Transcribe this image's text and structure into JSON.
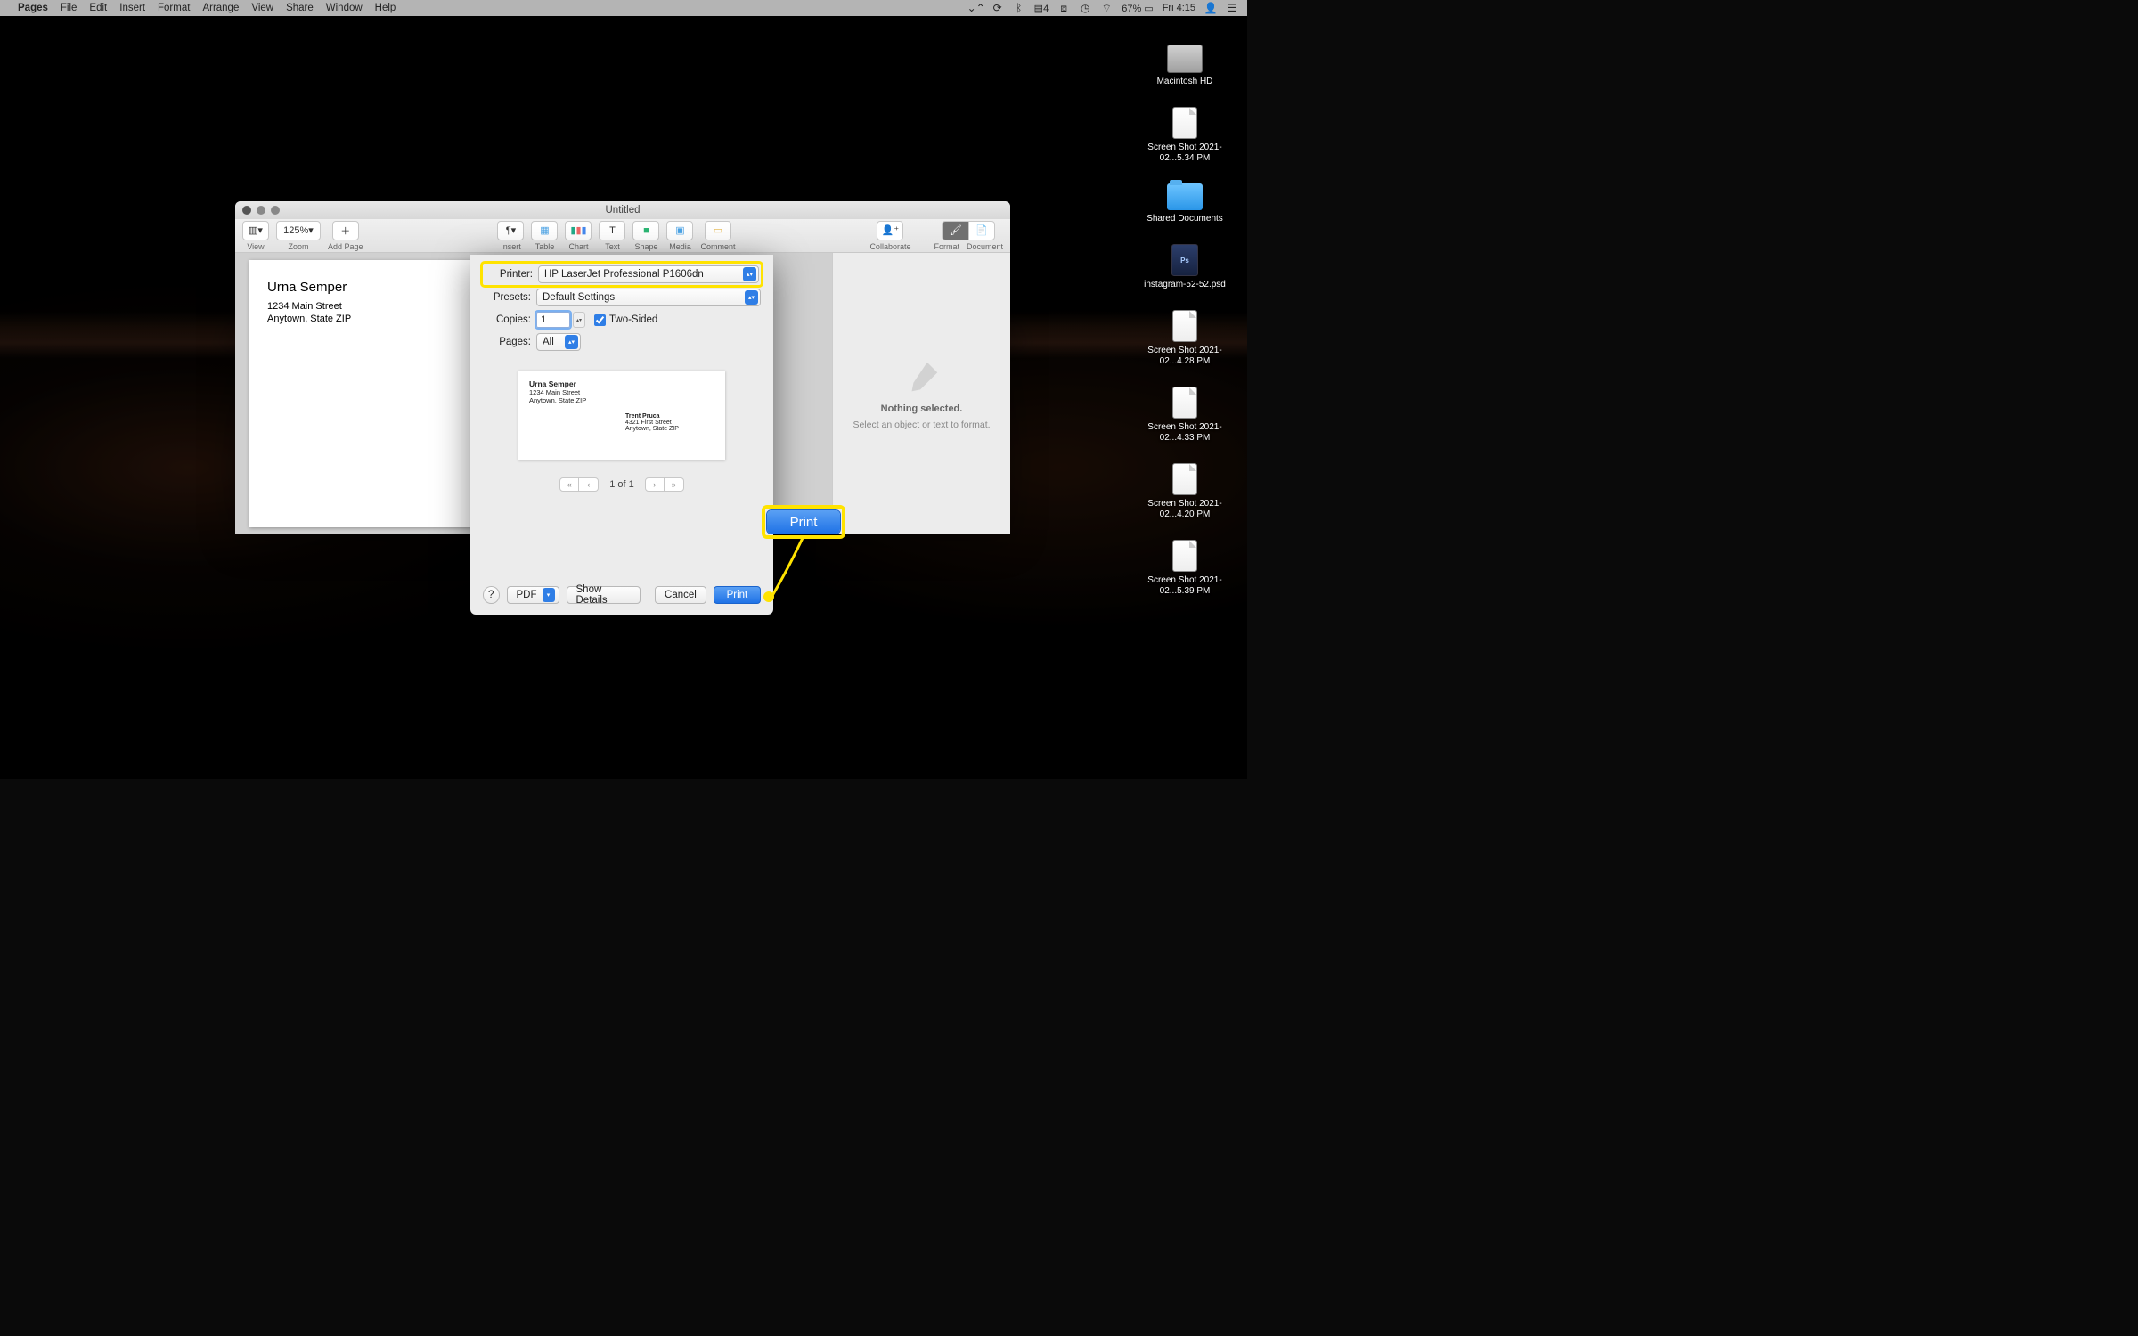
{
  "menubar": {
    "app": "Pages",
    "items": [
      "File",
      "Edit",
      "Insert",
      "Format",
      "Arrange",
      "View",
      "Share",
      "Window",
      "Help"
    ],
    "right": {
      "notif_badge": "4",
      "battery": "67%",
      "day": "Fri",
      "time": "4:15"
    }
  },
  "desktop": {
    "items": [
      {
        "kind": "hdd",
        "label": "Macintosh HD"
      },
      {
        "kind": "file",
        "label": "Screen Shot 2021-02...5.34 PM"
      },
      {
        "kind": "folder",
        "label": "Shared Documents"
      },
      {
        "kind": "psd",
        "label": "instagram-52-52.psd"
      },
      {
        "kind": "file",
        "label": "Screen Shot 2021-02...4.28 PM"
      },
      {
        "kind": "file",
        "label": "Screen Shot 2021-02...4.33 PM"
      },
      {
        "kind": "file",
        "label": "Screen Shot 2021-02...4.20 PM"
      },
      {
        "kind": "file",
        "label": "Screen Shot 2021-02...5.39 PM"
      }
    ]
  },
  "pages": {
    "title": "Untitled",
    "toolbar": {
      "zoom": "125%",
      "labels": {
        "view": "View",
        "zoom": "Zoom",
        "addpage": "Add Page",
        "insert": "Insert",
        "table": "Table",
        "chart": "Chart",
        "text": "Text",
        "shape": "Shape",
        "media": "Media",
        "comment": "Comment",
        "collaborate": "Collaborate",
        "format": "Format",
        "document": "Document"
      }
    },
    "doc": {
      "name": "Urna Semper",
      "addr1": "1234 Main Street",
      "addr2": "Anytown, State ZIP"
    },
    "inspector": {
      "line1": "Nothing selected.",
      "line2": "Select an object or text to format."
    }
  },
  "print": {
    "labels": {
      "printer": "Printer:",
      "presets": "Presets:",
      "copies": "Copies:",
      "pages": "Pages:",
      "twosided": "Two-Sided",
      "pageOf": "1 of 1",
      "help": "?",
      "pdf": "PDF",
      "showdetails": "Show Details",
      "cancel": "Cancel",
      "print": "Print"
    },
    "printer": "HP LaserJet Professional P1606dn",
    "preset": "Default Settings",
    "copies": "1",
    "two_sided": true,
    "pages": "All",
    "preview": {
      "ret_name": "Urna Semper",
      "ret_addr1": "1234 Main Street",
      "ret_addr2": "Anytown, State ZIP",
      "to_name": "Trent Pruca",
      "to_addr1": "4321 First Street",
      "to_addr2": "Anytown, State ZIP"
    }
  },
  "callout": {
    "print": "Print"
  }
}
